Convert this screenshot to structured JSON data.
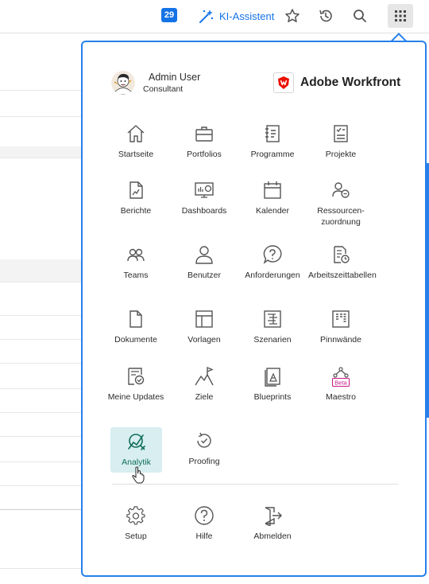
{
  "topbar": {
    "notification_count": "29",
    "ai_assistant_label": "KI-Assistent",
    "favorites_icon": "star-icon",
    "recents_icon": "history-icon",
    "search_icon": "search-icon",
    "main_menu_icon": "grid-icon"
  },
  "user": {
    "name": "Admin User",
    "role": "Consultant"
  },
  "brand": {
    "name": "Adobe Workfront",
    "accent": "#eb1000"
  },
  "menu": {
    "startseite": "Startseite",
    "portfolios": "Portfolios",
    "programme": "Programme",
    "projekte": "Projekte",
    "berichte": "Berichte",
    "dashboards": "Dashboards",
    "kalender": "Kalender",
    "ressourcen": "Ressourcen-zuordnung",
    "teams": "Teams",
    "benutzer": "Benutzer",
    "anforderungen": "Anforderungen",
    "arbeitszeittabellen": "Arbeitszeittabellen",
    "dokumente": "Dokumente",
    "vorlagen": "Vorlagen",
    "szenarien": "Szenarien",
    "pinnwaende": "Pinnwände",
    "meine_updates": "Meine Updates",
    "ziele": "Ziele",
    "blueprints": "Blueprints",
    "maestro": "Maestro",
    "maestro_badge": "Beta",
    "analytik": "Analytik",
    "proofing": "Proofing",
    "setup": "Setup",
    "hilfe": "Hilfe",
    "abmelden": "Abmelden"
  },
  "colors": {
    "accent_blue": "#1473e6",
    "panel_border": "#2680eb",
    "active_bg": "#d8eef0",
    "active_fg": "#0f6e58",
    "beta": "#c91b8a"
  }
}
